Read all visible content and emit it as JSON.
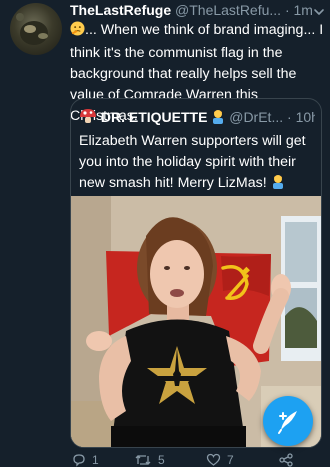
{
  "tweet": {
    "author_name": "TheLastRefuge",
    "author_handle": "@TheLastRefu...",
    "separator": "·",
    "time": "1m",
    "text": "... When we think of brand imaging... I think it's the communist flag in the background that really helps sell the value of Comrade Warren this Christmas.",
    "leading_emoji": "thinking-face-emoji"
  },
  "quoted": {
    "author_name": "DR. ETIQUETTE",
    "author_handle": "@DrEt...",
    "separator": "·",
    "time": "10h",
    "text": "Elizabeth Warren supporters will get you into the holiday spirit with their new smash hit!  Merry LizMas!",
    "name_emoji": "person-emoji",
    "text_emoji": "person-emoji",
    "avatar_icon": "red-mushroom-avatar"
  },
  "actions": {
    "reply_count": "1",
    "retweet_count": "5",
    "like_count": "7"
  },
  "colors": {
    "background": "#15202b",
    "muted": "#8899a6",
    "accent": "#1da1f2",
    "border": "#38444d"
  },
  "icons": {
    "more": "chevron-down-icon",
    "compose": "compose-tweet-icon",
    "reply": "reply-icon",
    "retweet": "retweet-icon",
    "like": "heart-icon",
    "share": "share-icon"
  }
}
